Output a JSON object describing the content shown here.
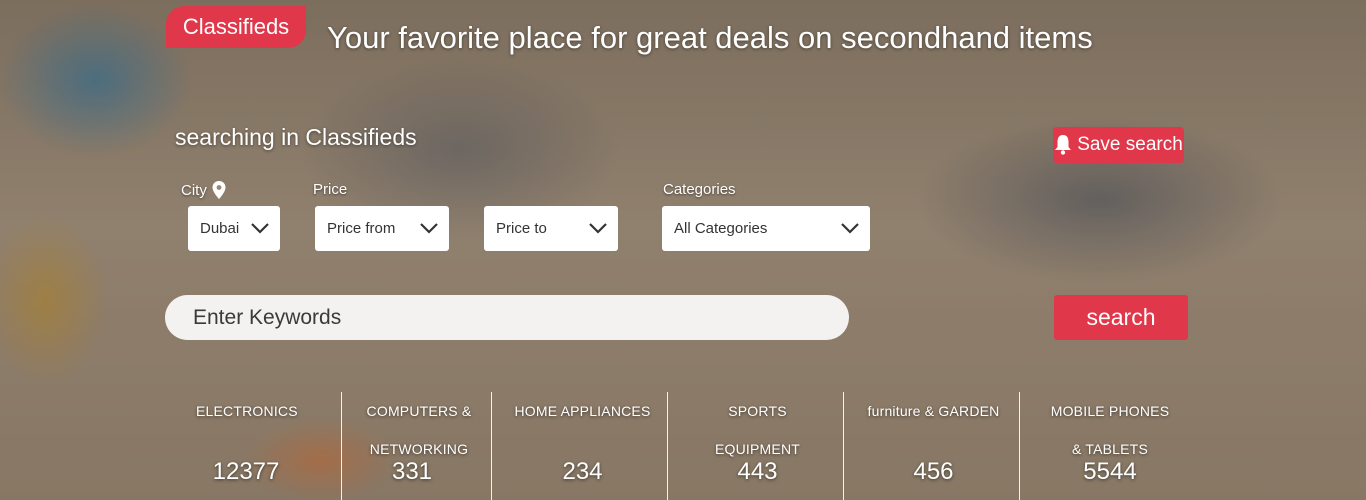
{
  "brand": {
    "label": "Classifieds"
  },
  "tagline": "Your favorite place for great deals on secondhand items",
  "searching_label": "searching in Classifieds",
  "save_search": {
    "label": "Save search",
    "icon": "bell-icon"
  },
  "filters": {
    "city": {
      "label": "City",
      "value": "Dubai",
      "icon": "map-pin-icon"
    },
    "price": {
      "label": "Price",
      "from_value": "Price from",
      "to_value": "Price to"
    },
    "categories": {
      "label": "Categories",
      "value": "All Categories"
    }
  },
  "keywords": {
    "placeholder": "Enter Keywords"
  },
  "search_button": {
    "label": "search"
  },
  "category_stats": [
    {
      "line1": "ELECTRONICS",
      "line2": "",
      "count": "12377"
    },
    {
      "line1": "COMPUTERS &",
      "line2": "NETWORKING",
      "count": "331"
    },
    {
      "line1": "HOME APPLIANCES",
      "line2": "",
      "count": "234"
    },
    {
      "line1": "SPORTS EQUIPMENT",
      "line2": "",
      "count": "443"
    },
    {
      "line1": "furniture & GARDEN",
      "line2": "",
      "count": "456"
    },
    {
      "line1": "MOBILE PHONES",
      "line2": "& TABLETS",
      "count": "5544"
    }
  ],
  "colors": {
    "accent": "#e0374a",
    "text": "#ffffff",
    "field_bg": "#ffffff"
  }
}
